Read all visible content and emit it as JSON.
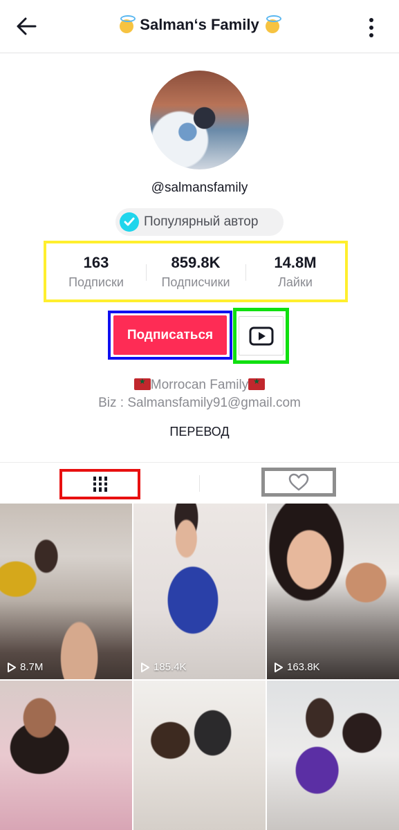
{
  "header": {
    "title": "Salman‘s Family",
    "back_icon": "arrow-left-icon",
    "more_icon": "more-vertical-icon"
  },
  "profile": {
    "username": "@salmansfamily",
    "badge_label": "Популярный автор"
  },
  "stats": [
    {
      "value": "163",
      "label": "Подписки"
    },
    {
      "value": "859.8K",
      "label": "Подписчики"
    },
    {
      "value": "14.8M",
      "label": "Лайки"
    }
  ],
  "actions": {
    "follow_label": "Подписаться",
    "youtube_icon": "youtube-icon"
  },
  "bio": {
    "line1": "Morrocan Family",
    "line2": "Biz : Salmansfamily91@gmail.com",
    "translate_label": "ПЕРЕВОД"
  },
  "tabs": {
    "videos_icon": "grid-icon",
    "liked_icon": "heart-icon"
  },
  "videos": [
    {
      "views": "8.7M"
    },
    {
      "views": "185.4K"
    },
    {
      "views": "163.8K"
    },
    {
      "views": ""
    },
    {
      "views": ""
    },
    {
      "views": ""
    }
  ],
  "colors": {
    "follow_button": "#fe2c55",
    "verified": "#20d5ec",
    "highlight_stats": "#ffef2e",
    "highlight_follow": "#1010f0",
    "highlight_youtube": "#10e010",
    "highlight_videos_tab": "#e81010",
    "highlight_liked_tab": "#8e8e8e"
  }
}
